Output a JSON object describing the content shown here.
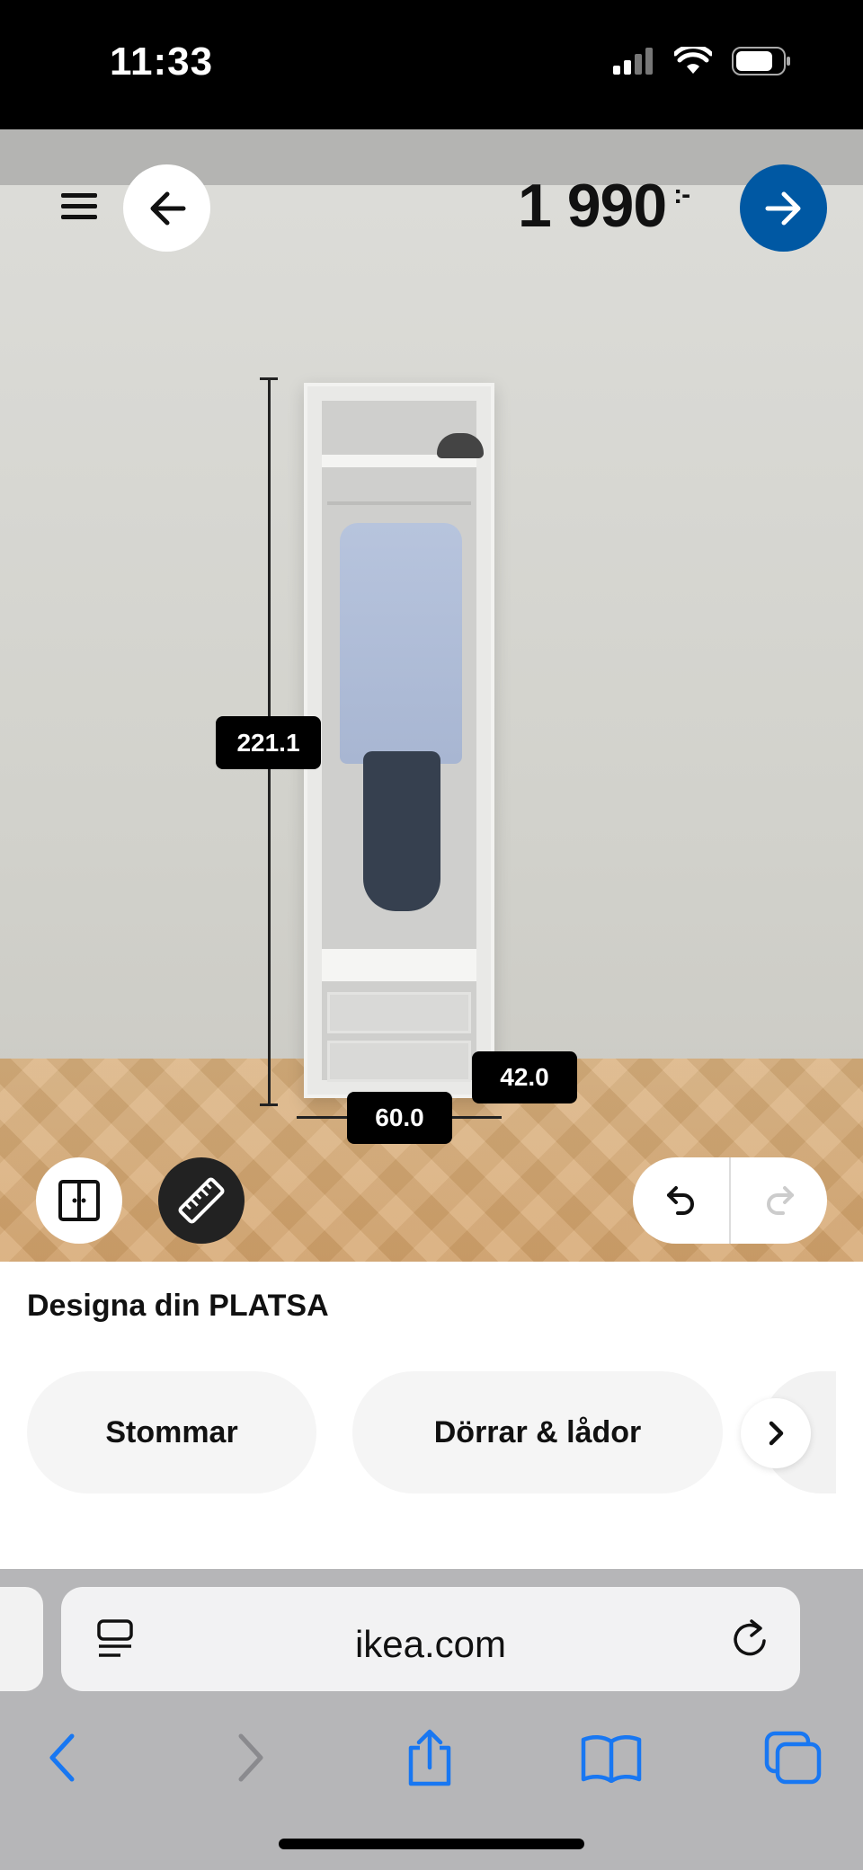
{
  "status_bar": {
    "time": "11:33"
  },
  "header": {
    "price": "1 990",
    "price_suffix": ":-"
  },
  "dimensions": {
    "height": "221.1",
    "width": "60.0",
    "depth": "42.0"
  },
  "panel": {
    "title": "Designa din PLATSA",
    "categories": [
      "Stommar",
      "Dörrar & lådor"
    ]
  },
  "browser": {
    "url": "ikea.com"
  },
  "colors": {
    "brand_blue": "#0058a3",
    "safari_blue": "#1877f2"
  },
  "icons": {
    "menu": "hamburger-menu-icon",
    "back": "arrow-left-icon",
    "next": "arrow-right-icon",
    "doors": "wardrobe-doors-icon",
    "measure": "ruler-icon",
    "undo": "undo-icon",
    "redo": "redo-icon"
  }
}
